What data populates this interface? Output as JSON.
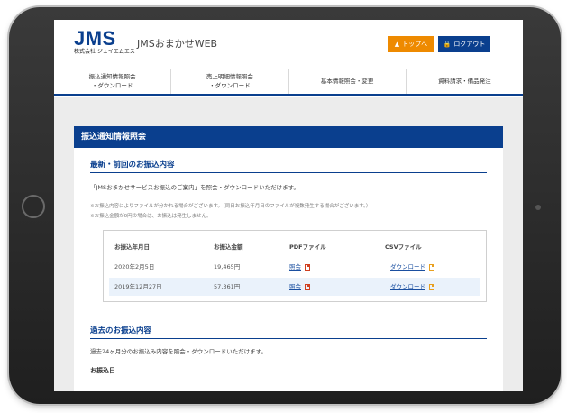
{
  "header": {
    "logo": "JMS",
    "logo_sub": "株式会社 ジェイエムエス",
    "site_name": "JMSおまかせWEB",
    "top_button": "トップへ",
    "logout_button": "ログアウト"
  },
  "nav": {
    "items": [
      {
        "label": "振込通知情報照会\n・ダウンロード"
      },
      {
        "label": "売上明細情報照会\n・ダウンロード"
      },
      {
        "label": "基本情報照会・変更"
      },
      {
        "label": "資料請求・備品発注"
      }
    ]
  },
  "panel": {
    "title": "振込通知情報照会",
    "latest_title": "最新・前回のお振込内容",
    "latest_desc": "「JMSおまかせサービスお振込のご案内」を照会・ダウンロードいただけます。",
    "note1": "※お振込内容によりファイルが分かれる場合がございます。（同日お振込年月日のファイルが複数発生する場合がございます。）",
    "note2": "※お振込金額が0円の場合は、お振込は発生しません。",
    "table": {
      "headers": {
        "date": "お振込年月日",
        "amount": "お振込金額",
        "pdf": "PDFファイル",
        "csv": "CSVファイル"
      },
      "rows": [
        {
          "date": "2020年2月5日",
          "amount": "19,465円",
          "pdf": "照会",
          "csv": "ダウンロード"
        },
        {
          "date": "2019年12月27日",
          "amount": "57,361円",
          "pdf": "照会",
          "csv": "ダウンロード"
        }
      ]
    },
    "past_title": "過去のお振込内容",
    "past_desc": "過去24ヶ月分のお振込み内容を照会・ダウンロードいただけます。",
    "past_field": "お振込日"
  },
  "icons": {
    "top": "arrow-up-icon",
    "logout": "lock-icon",
    "pdf": "pdf-file-icon",
    "csv": "csv-file-icon"
  },
  "colors": {
    "brand": "#0a3f8e",
    "accent": "#ee8a00"
  }
}
